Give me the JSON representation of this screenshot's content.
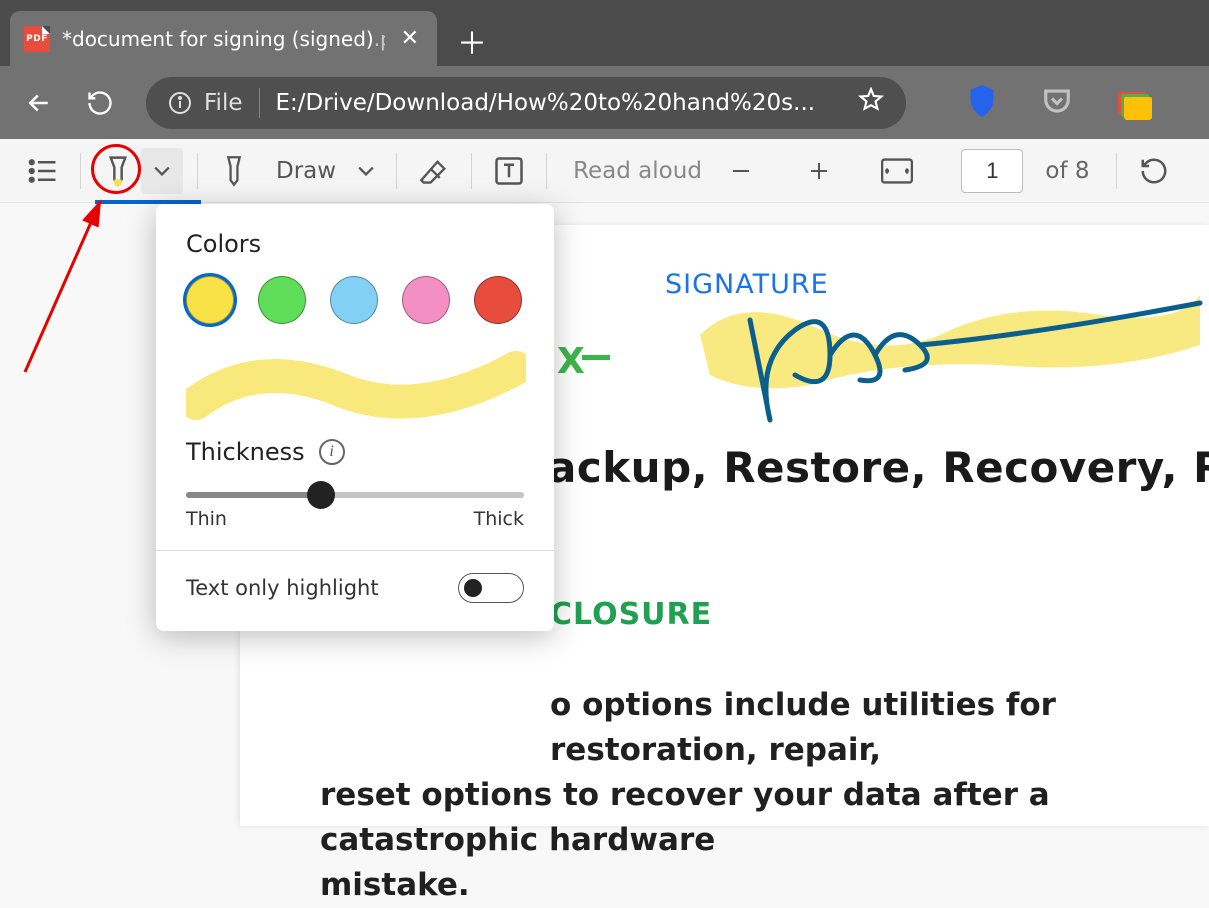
{
  "browser": {
    "tab_title_main": "*document for signing (signed)",
    "tab_title_ext": ".p",
    "url_scheme_label": "File",
    "url_text": "E:/Drive/Download/How%20to%20hand%20s...",
    "file_icon_label": "PDF"
  },
  "pdf_toolbar": {
    "draw_label": "Draw",
    "read_aloud": "Read aloud",
    "page_current": "1",
    "page_total": "of 8"
  },
  "popover": {
    "colors_title": "Colors",
    "colors": {
      "yellow": "#f9e246",
      "green": "#5fdd58",
      "blue": "#82d1f5",
      "pink": "#f48fc4",
      "red": "#e74c3c"
    },
    "selected_color": "yellow",
    "thickness_title": "Thickness",
    "slider": {
      "min_label": "Thin",
      "max_label": "Thick",
      "percent": 40
    },
    "toggle_label": "Text only highlight",
    "toggle_on": false
  },
  "document": {
    "signature_label": "SIGNATURE",
    "x_mark": "X",
    "heading": "ackup, Restore, Recovery, Repair, R",
    "closure": "CLOSURE",
    "body_line1": "o options include utilities for restoration, repair,",
    "body_line2": "reset options to recover your data after a catastrophic hardware",
    "body_line3": "mistake."
  }
}
